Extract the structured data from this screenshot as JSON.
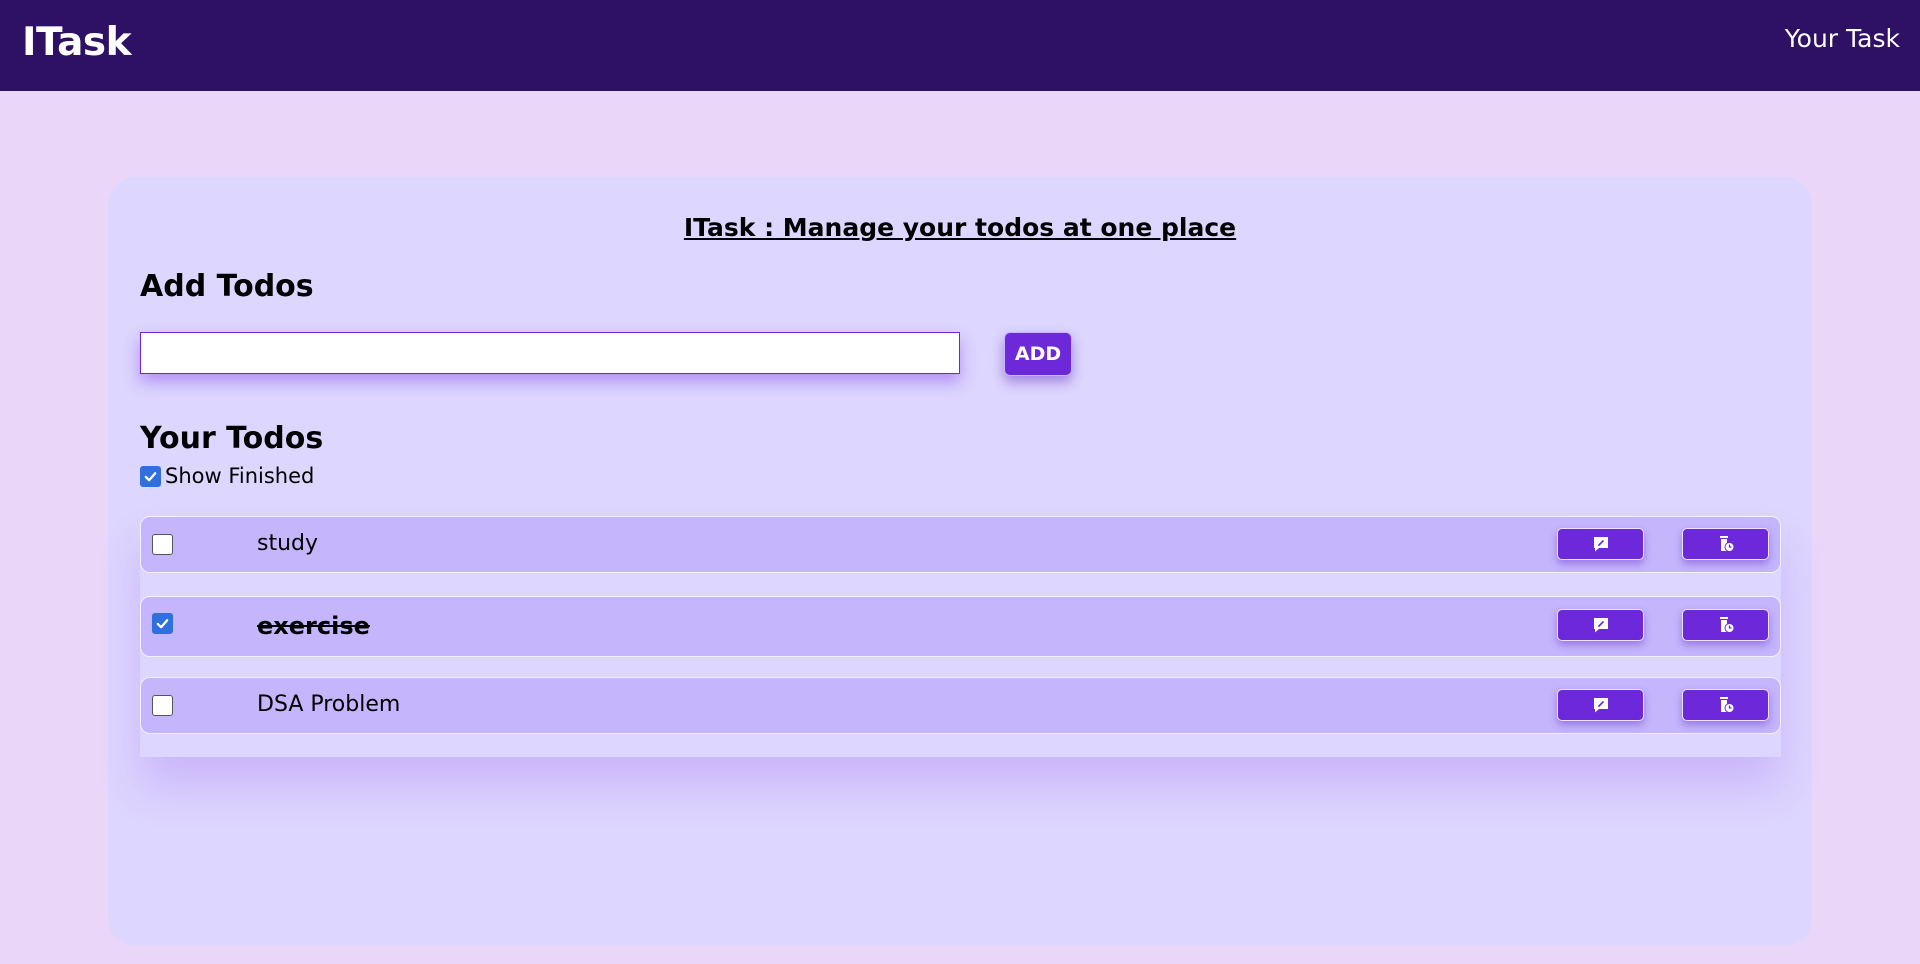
{
  "navbar": {
    "brand": "ITask",
    "link": "Your Task"
  },
  "main": {
    "heading": "ITask : Manage your todos at one place",
    "add_section_title": "Add Todos",
    "input_value": "",
    "add_button_label": "ADD",
    "todos_section_title": "Your Todos",
    "show_finished_label": "Show Finished",
    "show_finished_checked": true,
    "todos": [
      {
        "text": "study",
        "completed": false
      },
      {
        "text": "exercise",
        "completed": true
      },
      {
        "text": "DSA Problem",
        "completed": false
      }
    ],
    "row_actions": [
      {
        "icon": "edit-icon"
      },
      {
        "icon": "delete-icon"
      }
    ]
  },
  "colors": {
    "navbar": "#2e1065",
    "page_background": "#ead6f9",
    "card_background": "#ddd6fe",
    "row_background": "#c4b5fd",
    "accent": "#6d28d9",
    "checkbox_checked": "#2f6fde"
  }
}
